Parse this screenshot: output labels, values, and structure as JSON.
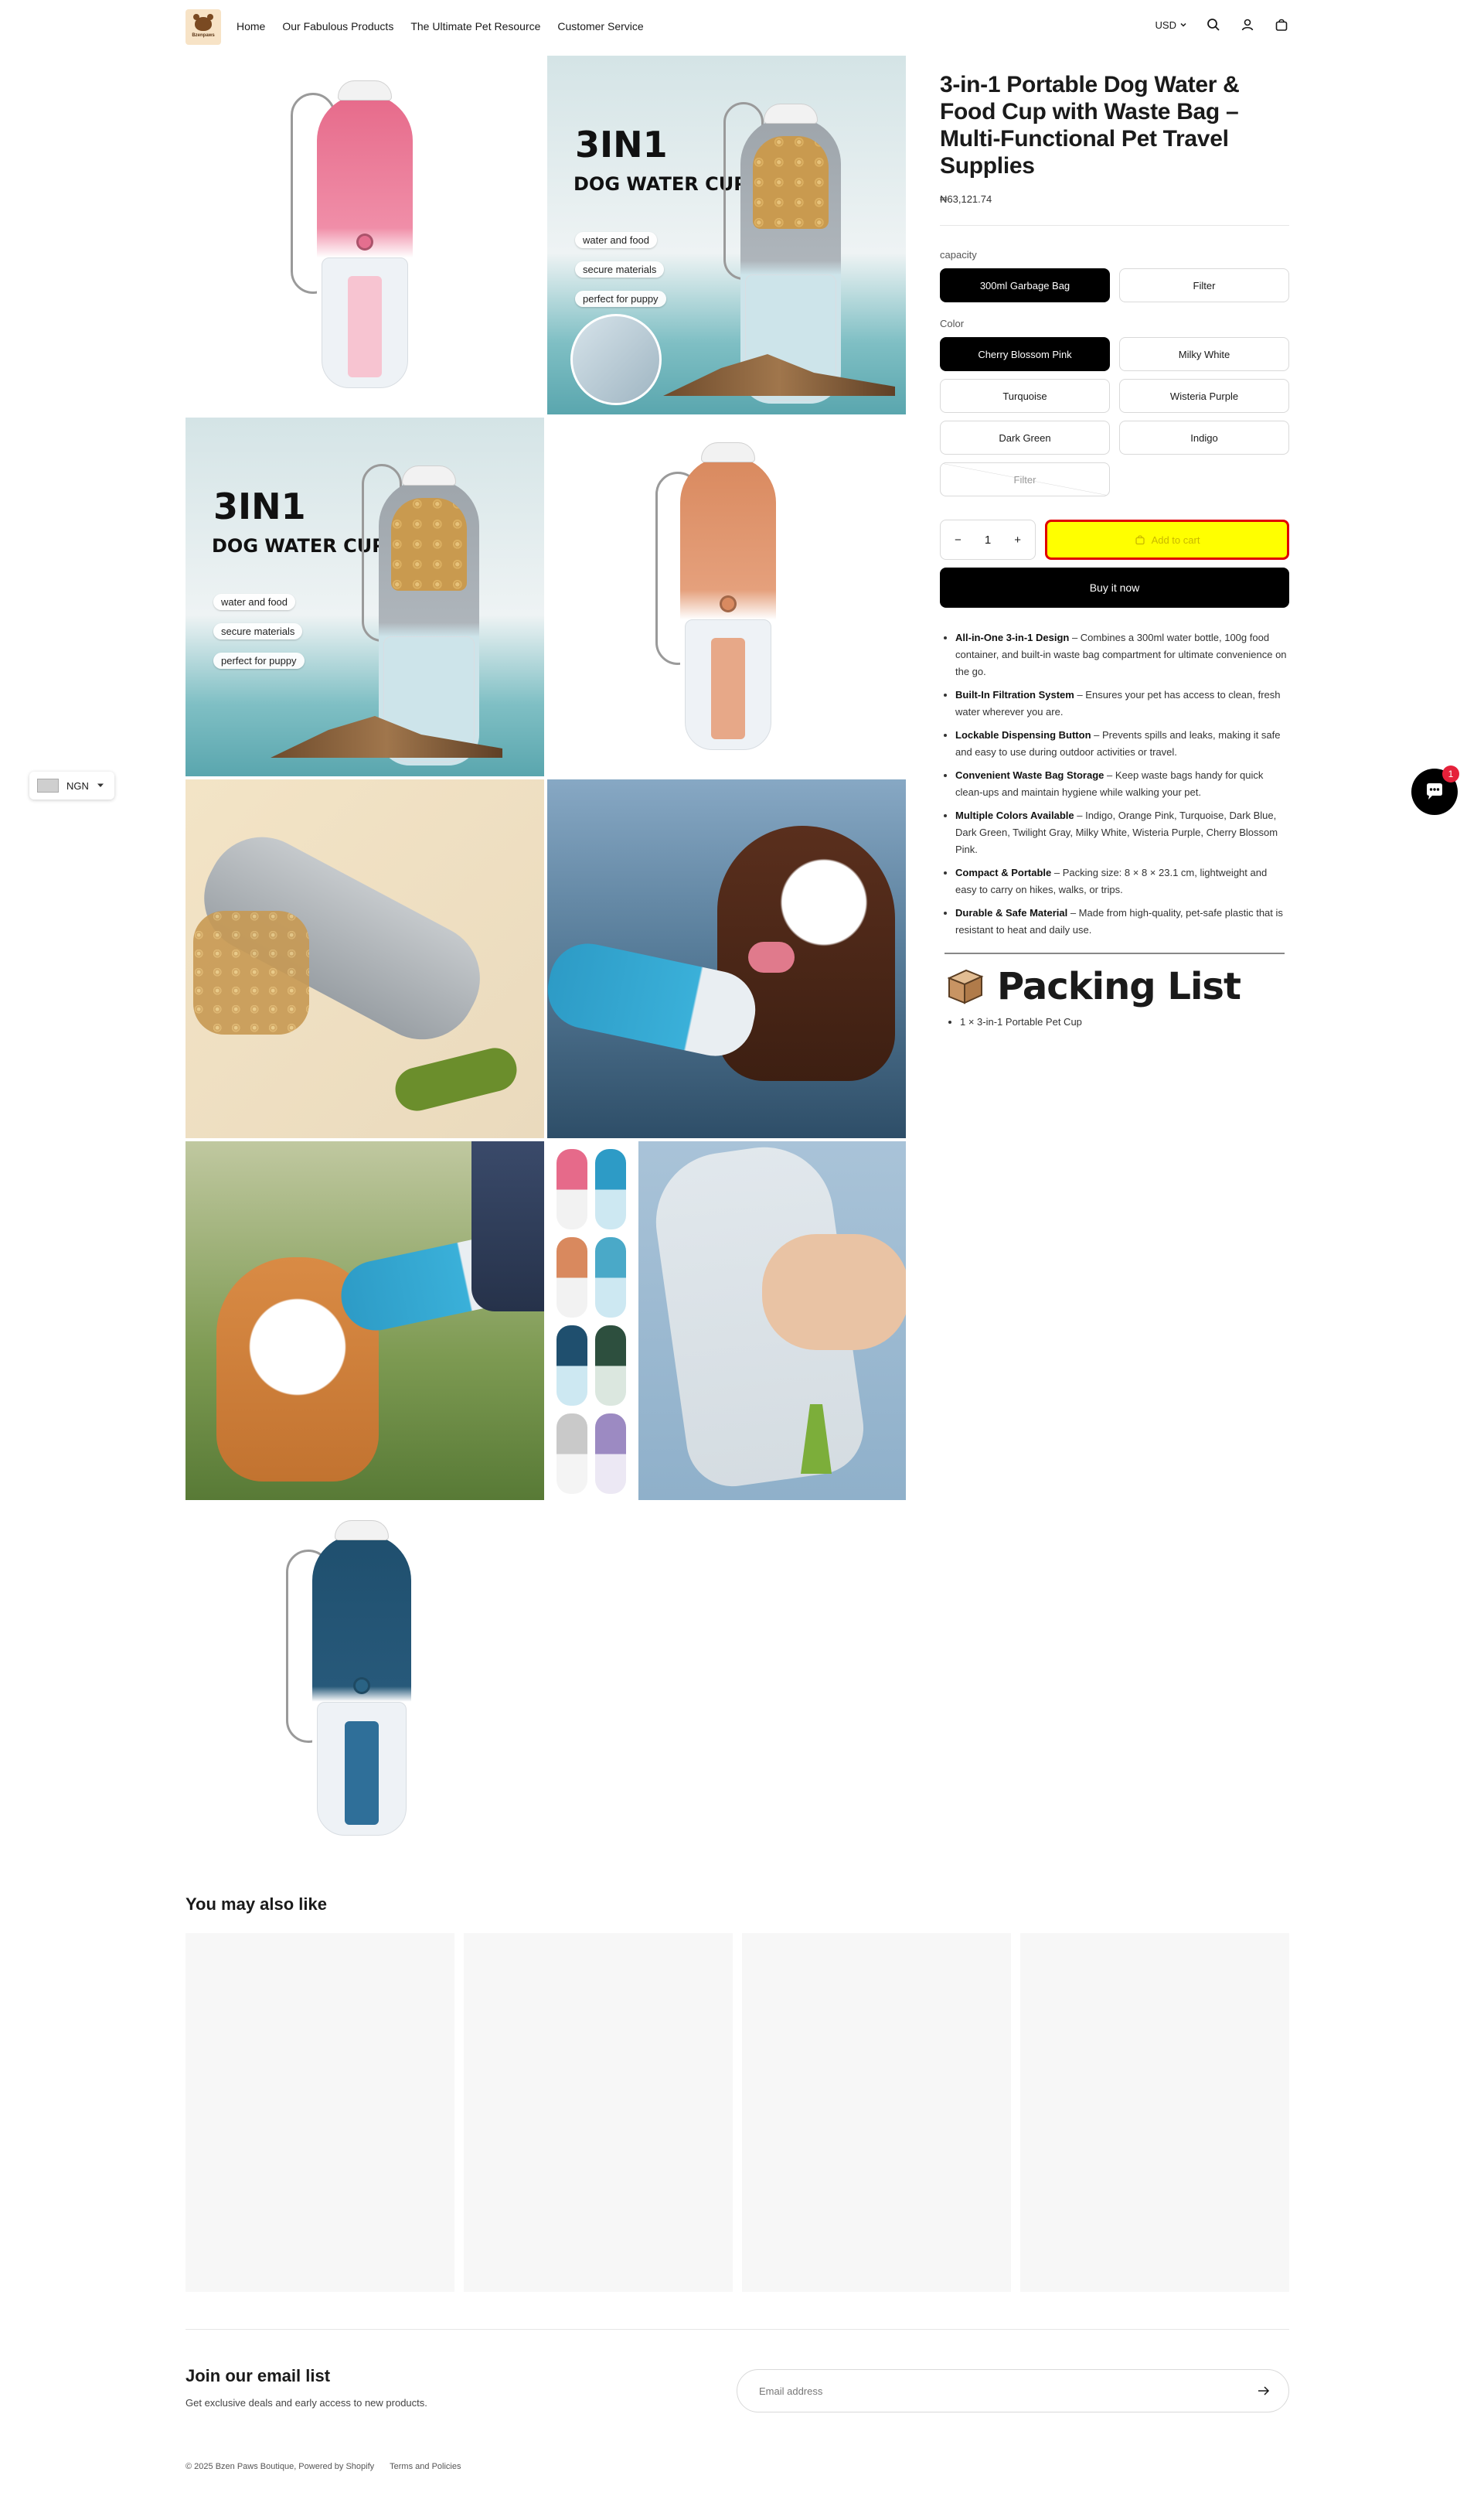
{
  "header": {
    "logo_text": "Bzenpaws",
    "nav": [
      "Home",
      "Our Fabulous Products",
      "The Ultimate Pet Resource",
      "Customer Service"
    ],
    "currency": "USD",
    "icons": [
      "search-icon",
      "account-icon",
      "cart-icon"
    ]
  },
  "gallery": {
    "overlay_title_1": "3IN1",
    "overlay_title_2": "DOG WATER CUP",
    "overlay_pills": [
      "water and food",
      "secure materials",
      "perfect for puppy"
    ]
  },
  "product": {
    "title": "3-in-1 Portable Dog Water & Food Cup with Waste Bag – Multi-Functional Pet Travel Supplies",
    "price": "₦63,121.74",
    "capacity_label": "capacity",
    "capacity_options": [
      "300ml Garbage Bag",
      "Filter"
    ],
    "capacity_selected": "300ml Garbage Bag",
    "color_label": "Color",
    "color_options": [
      "Cherry Blossom Pink",
      "Milky White",
      "Turquoise",
      "Wisteria Purple",
      "Dark Green",
      "Indigo",
      "Filter"
    ],
    "color_selected": "Cherry Blossom Pink",
    "quantity": "1",
    "qty_minus": "−",
    "qty_plus": "+",
    "add_to_cart": "Add to cart",
    "buy_now": "Buy it now",
    "features": [
      {
        "bold": "All-in-One 3-in-1 Design",
        "text": " – Combines a 300ml water bottle, 100g food container, and built-in waste bag compartment for ultimate convenience on the go."
      },
      {
        "bold": "Built-In Filtration System",
        "text": " – Ensures your pet has access to clean, fresh water wherever you are."
      },
      {
        "bold": "Lockable Dispensing Button",
        "text": " – Prevents spills and leaks, making it safe and easy to use during outdoor activities or travel."
      },
      {
        "bold": "Convenient Waste Bag Storage",
        "text": " – Keep waste bags handy for quick clean-ups and maintain hygiene while walking your pet."
      },
      {
        "bold": "Multiple Colors Available",
        "text": " – Indigo, Orange Pink, Turquoise, Dark Blue, Dark Green, Twilight Gray, Milky White, Wisteria Purple, Cherry Blossom Pink."
      },
      {
        "bold": "Compact & Portable",
        "text": " – Packing size: 8 × 8 × 23.1 cm, lightweight and easy to carry on hikes, walks, or trips."
      },
      {
        "bold": "Durable & Safe Material",
        "text": " – Made from high-quality, pet-safe plastic that is resistant to heat and daily use."
      }
    ],
    "packing_title": "Packing List",
    "packing_items": [
      "1 × 3-in-1 Portable Pet Cup"
    ]
  },
  "currency_selector": {
    "code": "NGN"
  },
  "chat": {
    "badge": "1"
  },
  "recommendations": {
    "title": "You may also like"
  },
  "newsletter": {
    "title": "Join our email list",
    "subtitle": "Get exclusive deals and early access to new products.",
    "placeholder": "Email address"
  },
  "footer": {
    "copyright": "© 2025 Bzen Paws Boutique, Powered by Shopify",
    "link": "Terms and Policies"
  },
  "colors": {
    "accent_yellow": "#ffff00",
    "accent_red_border": "#e00000",
    "black": "#000000"
  }
}
